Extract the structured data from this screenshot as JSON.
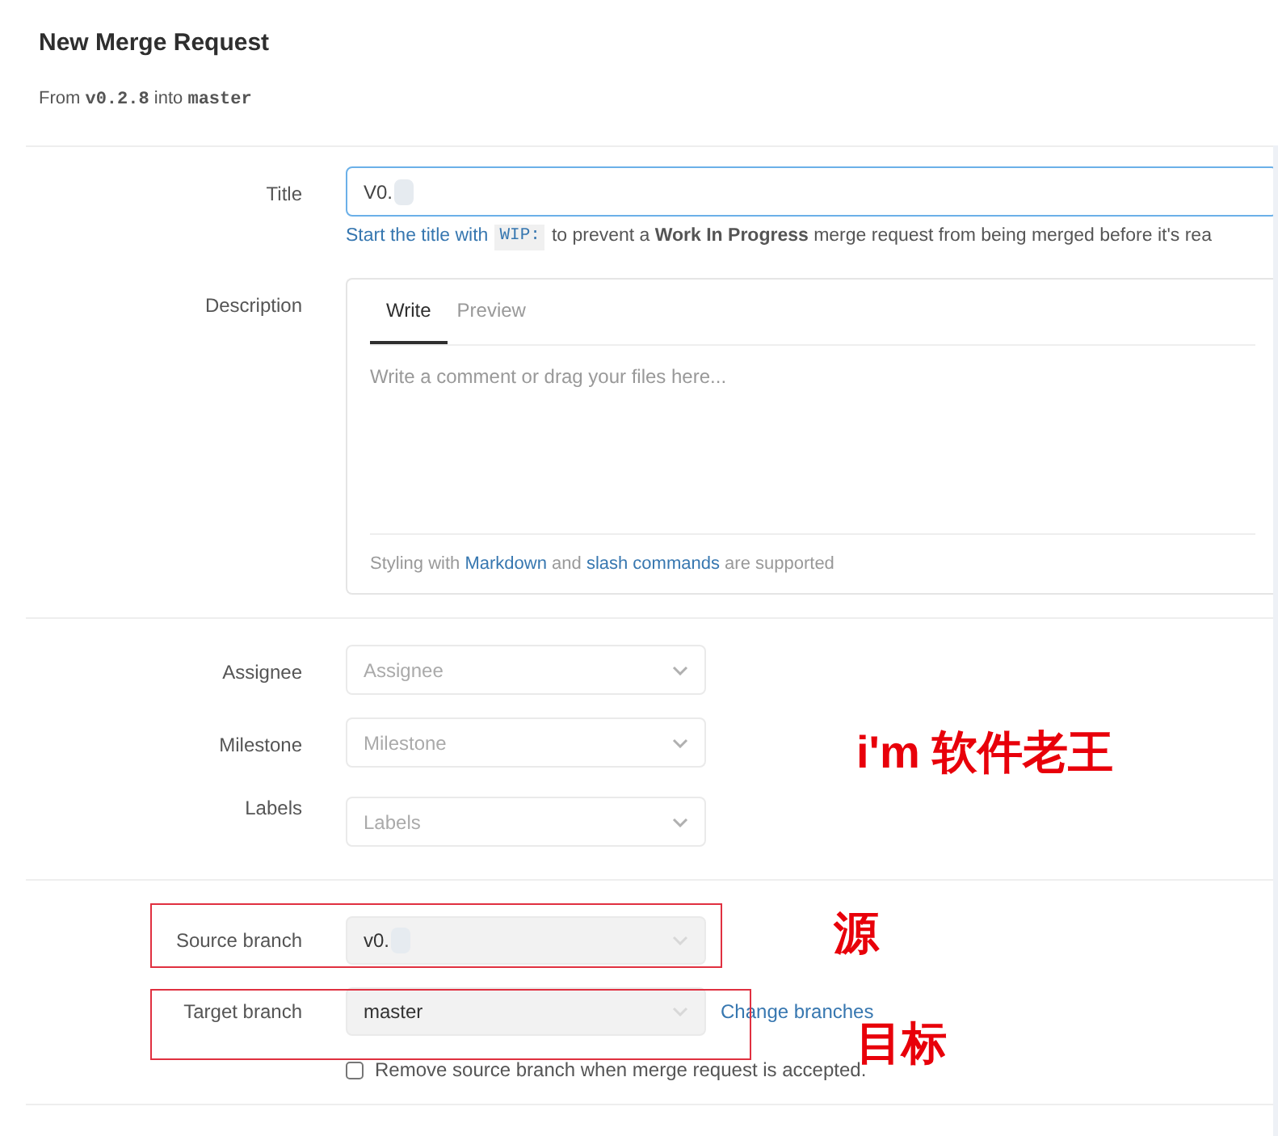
{
  "header": {
    "title": "New Merge Request",
    "from_prefix": "From",
    "source": "v0.2.8",
    "into": "into",
    "target": "master"
  },
  "title_field": {
    "label": "Title",
    "value": "V0.",
    "hint_link": "Start the title with",
    "hint_code": "WIP:",
    "hint_rest": "to prevent a **Work In Progress** merge request from being merged before it's rea"
  },
  "description": {
    "label": "Description",
    "tabs": [
      {
        "label": "Write",
        "selected": true
      },
      {
        "label": "Preview",
        "selected": false
      }
    ],
    "placeholder": "Write a comment or drag your files here...",
    "footer_parts": [
      {
        "text": "Styling with",
        "kind": "text"
      },
      {
        "text": "Markdown",
        "kind": "link"
      },
      {
        "text": "and",
        "kind": "text"
      },
      {
        "text": "slash commands",
        "kind": "link"
      },
      {
        "text": "are supported",
        "kind": "text"
      }
    ]
  },
  "metadata": [
    {
      "label": "Assignee",
      "placeholder": "Assignee"
    },
    {
      "label": "Milestone",
      "placeholder": "Milestone"
    },
    {
      "label": "Labels",
      "placeholder": "Labels"
    }
  ],
  "branches": [
    {
      "label": "Source branch",
      "value": "v0."
    },
    {
      "label": "Target branch",
      "value": "master",
      "link": "Change branches"
    }
  ],
  "remove_source": {
    "label": "Remove source branch when merge request is accepted.",
    "checked": false
  },
  "annotations": [
    "i'm 软件老王",
    "源",
    "目标"
  ]
}
